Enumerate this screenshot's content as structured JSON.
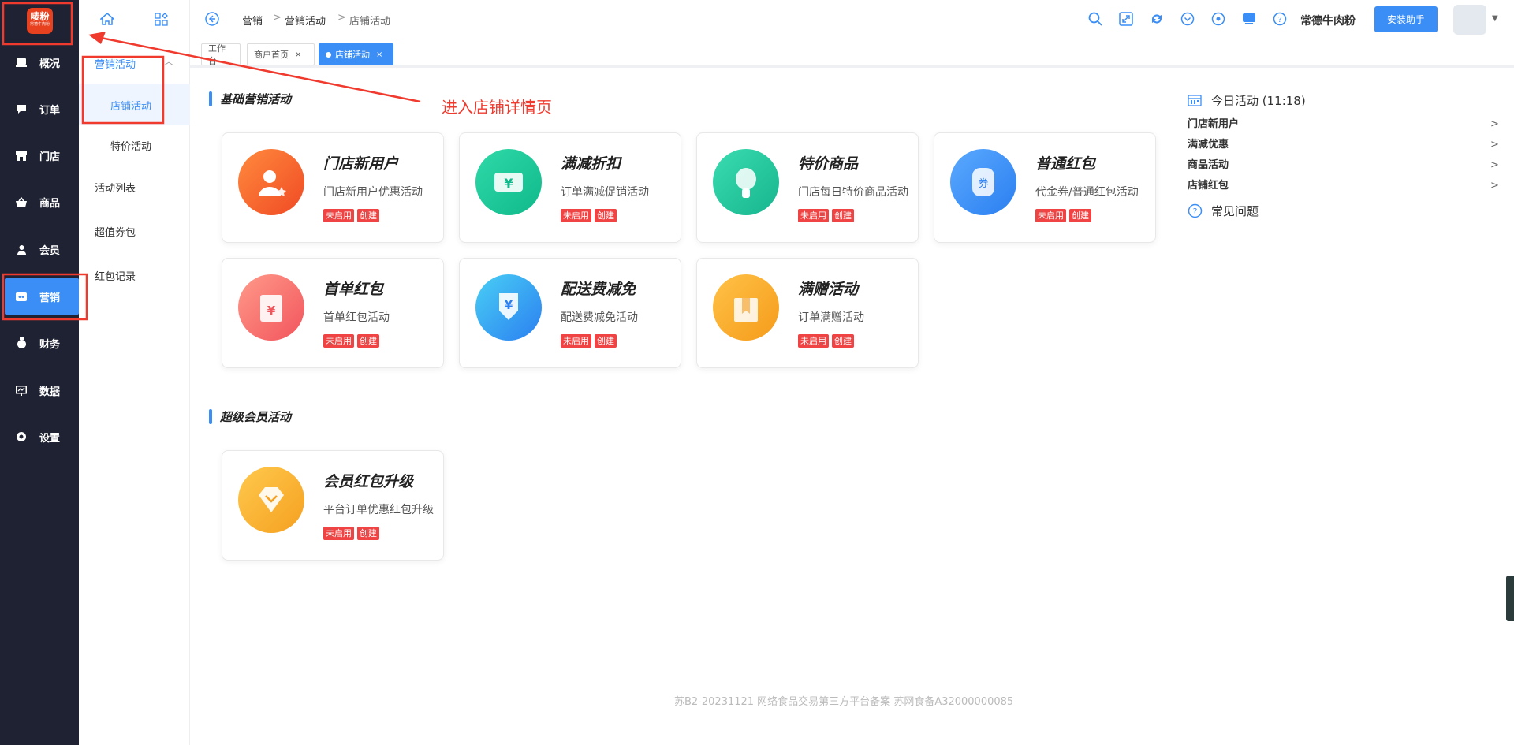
{
  "logo": {
    "text": "唛粉",
    "sub": "常德牛肉粉"
  },
  "nav": [
    {
      "label": "概况",
      "icon": "overview-icon"
    },
    {
      "label": "订单",
      "icon": "order-icon"
    },
    {
      "label": "门店",
      "icon": "store-icon"
    },
    {
      "label": "商品",
      "icon": "goods-icon"
    },
    {
      "label": "会员",
      "icon": "member-icon"
    },
    {
      "label": "营销",
      "icon": "marketing-icon"
    },
    {
      "label": "财务",
      "icon": "finance-icon"
    },
    {
      "label": "数据",
      "icon": "data-icon"
    },
    {
      "label": "设置",
      "icon": "settings-icon"
    }
  ],
  "sub_nav": {
    "group": "营销活动",
    "items": [
      "店铺活动",
      "特价活动",
      "活动列表",
      "超值券包",
      "红包记录"
    ]
  },
  "breadcrumb": [
    "营销",
    "营销活动",
    "店铺活动"
  ],
  "header": {
    "shop_name": "常德牛肉粉",
    "install_btn": "安装助手"
  },
  "tabs": [
    {
      "label": "工作台"
    },
    {
      "label": "商户首页",
      "close": "×"
    },
    {
      "label": "店铺活动",
      "close": "×"
    }
  ],
  "sections": {
    "basic": "基础营销活动",
    "super": "超级会员活动"
  },
  "tags": {
    "disabled": "未启用",
    "create": "创建"
  },
  "cards": [
    {
      "title": "门店新用户",
      "desc": "门店新用户优惠活动",
      "color1": "#ff8a3d",
      "color2": "#f04a24",
      "icon": "new-user-icon"
    },
    {
      "title": "满减折扣",
      "desc": "订单满减促销活动",
      "color1": "#2fd9a8",
      "color2": "#10b98a",
      "icon": "discount-ticket-icon"
    },
    {
      "title": "特价商品",
      "desc": "门店每日特价商品活动",
      "color1": "#3adcb0",
      "color2": "#17b58e",
      "icon": "cabbage-icon"
    },
    {
      "title": "普通红包",
      "desc": "代金券/普通红包活动",
      "color1": "#5aa9ff",
      "color2": "#2b7ff0",
      "icon": "coupon-icon"
    },
    {
      "title": "首单红包",
      "desc": "首单红包活动",
      "color1": "#ff9a8a",
      "color2": "#f2545c",
      "icon": "red-envelope-icon"
    },
    {
      "title": "配送费减免",
      "desc": "配送费减免活动",
      "color1": "#49cff5",
      "color2": "#2b7ff0",
      "icon": "delivery-fee-icon"
    },
    {
      "title": "满赠活动",
      "desc": "订单满赠活动",
      "color1": "#ffc247",
      "color2": "#f59b1a",
      "icon": "gift-box-icon"
    },
    {
      "title": "会员红包升级",
      "desc": "平台订单优惠红包升级",
      "color1": "#ffc94d",
      "color2": "#f5a020",
      "icon": "diamond-icon"
    }
  ],
  "today": {
    "title": "今日活动 (11:18)",
    "items": [
      "门店新用户",
      "满减优惠",
      "商品活动",
      "店铺红包"
    ],
    "faq": "常见问题"
  },
  "annotation": "进入店铺详情页",
  "footer": "苏B2-20231121   网络食品交易第三方平台备案 苏网食备A32000000085"
}
